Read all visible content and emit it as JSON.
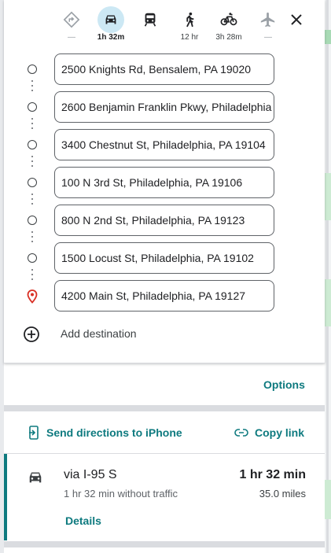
{
  "colors": {
    "accent": "#0e7a7f",
    "active_mode_bg": "#cce8f4",
    "pin": "#d93025"
  },
  "modes": [
    {
      "name": "best-mode",
      "icon": "directions-diamond-icon",
      "label": "—"
    },
    {
      "name": "driving",
      "icon": "car-icon",
      "label": "1h 32m",
      "active": true
    },
    {
      "name": "transit",
      "icon": "train-icon",
      "label": ""
    },
    {
      "name": "walking",
      "icon": "walk-icon",
      "label": "12 hr"
    },
    {
      "name": "cycling",
      "icon": "bike-icon",
      "label": "3h 28m"
    },
    {
      "name": "flights",
      "icon": "airplane-icon",
      "label": "—"
    }
  ],
  "stops": [
    "2500 Knights Rd, Bensalem, PA 19020",
    "2600 Benjamin Franklin Pkwy, Philadelphia",
    "3400 Chestnut St, Philadelphia, PA 19104",
    "100 N 3rd St, Philadelphia, PA 19106",
    "800 N 2nd St, Philadelphia, PA 19123",
    "1500 Locust St, Philadelphia, PA 19102",
    "4200 Main St, Philadelphia, PA 19127"
  ],
  "add_destination": "Add destination",
  "options_label": "Options",
  "send_directions": "Send directions to iPhone",
  "copy_link": "Copy link",
  "route": {
    "via": "via I-95 S",
    "duration": "1 hr 32 min",
    "subtitle": "1 hr 32 min without traffic",
    "distance": "35.0 miles",
    "details_label": "Details"
  }
}
